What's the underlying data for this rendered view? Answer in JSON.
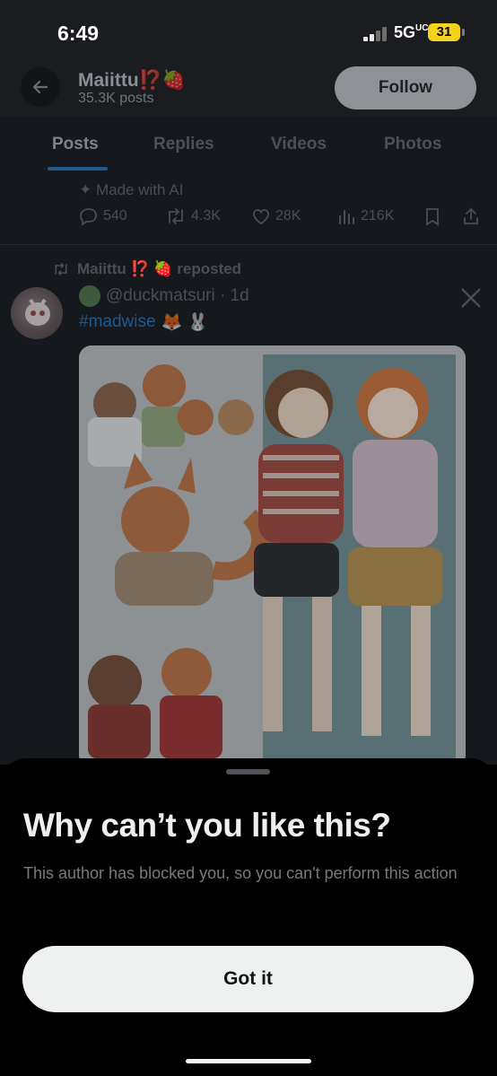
{
  "status_bar": {
    "time": "6:49",
    "network": "5G",
    "network_suffix": "UC",
    "battery": "31"
  },
  "header": {
    "name": "Maiittu",
    "name_emojis": "⁉️🍓",
    "posts": "35.3K posts",
    "follow_label": "Follow",
    "back_icon": "arrow-left-icon"
  },
  "tabs": [
    {
      "label": "Posts",
      "active": true
    },
    {
      "label": "Replies"
    },
    {
      "label": "Videos"
    },
    {
      "label": "Photos"
    }
  ],
  "prev_post": {
    "made_with_ai": "Made with AI",
    "replies": "540",
    "reposts": "4.3K",
    "likes": "28K",
    "views": "216K"
  },
  "post": {
    "repost_label": "Maiittu ⁉️ 🍓 reposted",
    "handle": "@duckmatsuri · 1d",
    "hashtag": "#madwise",
    "hashtag_emojis": "🦊 🐰"
  },
  "sheet": {
    "title": "Why can’t you like this?",
    "body": "This author has blocked you, so you can't perform this action",
    "button": "Got it"
  },
  "colors": {
    "accent": "#1d9bf0",
    "sheet_bg": "#000000",
    "button_bg": "#eff3f4",
    "battery": "#f5d21c"
  }
}
